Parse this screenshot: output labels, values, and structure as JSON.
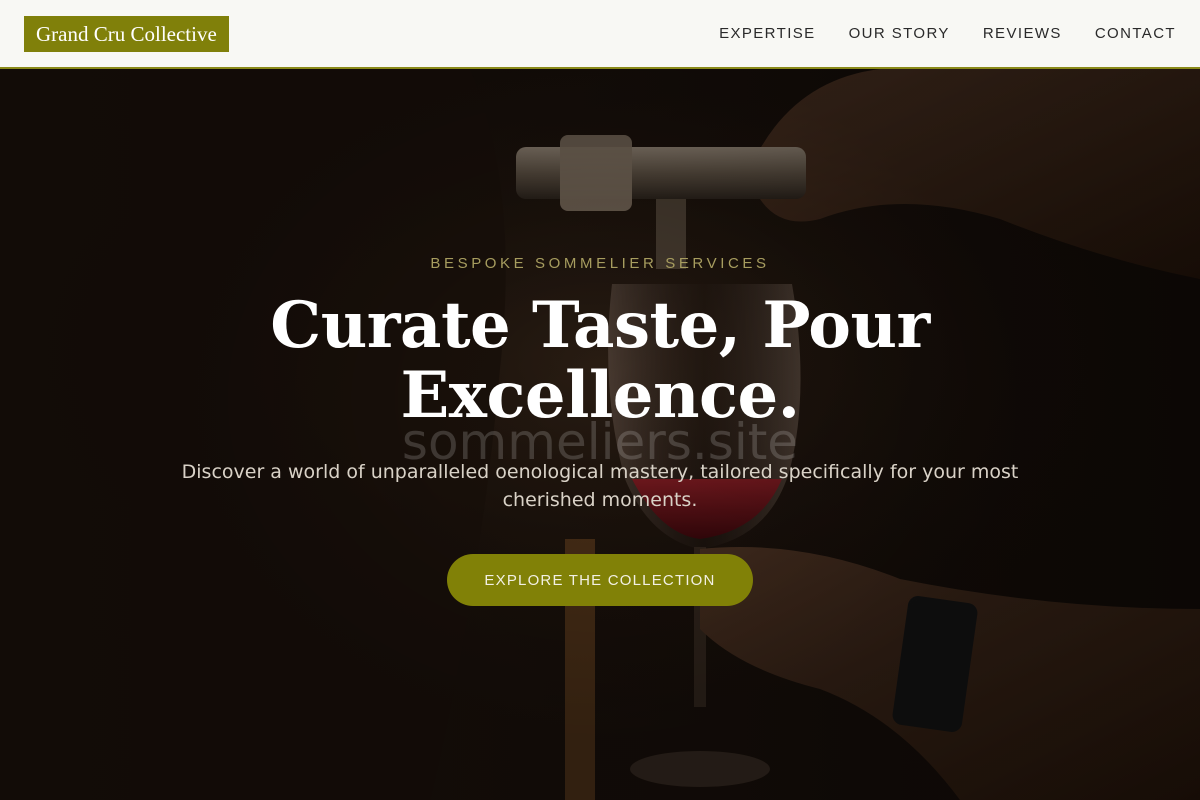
{
  "brand": {
    "name": "Grand Cru Collective",
    "accent": "#80800a"
  },
  "nav": {
    "items": [
      {
        "label": "EXPERTISE"
      },
      {
        "label": "OUR STORY"
      },
      {
        "label": "REVIEWS"
      },
      {
        "label": "CONTACT"
      }
    ]
  },
  "hero": {
    "eyebrow": "BESPOKE SOMMELIER SERVICES",
    "headline": "Curate Taste, Pour Excellence.",
    "watermark": "sommeliers.site",
    "subtitle": "Discover a world of unparalleled oenological mastery, tailored specifically for your most cherished moments.",
    "cta_label": "EXPLORE THE COLLECTION",
    "background": "dark photo of hands pouring red wine into a glass through an aerator"
  }
}
